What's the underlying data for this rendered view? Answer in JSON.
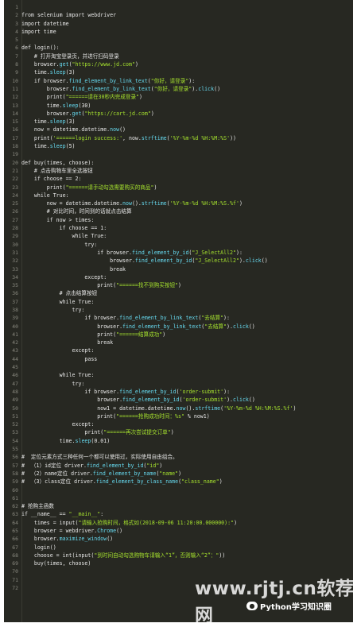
{
  "editor": {
    "lines": [
      {
        "n": "1",
        "t": ""
      },
      {
        "n": "2",
        "t": "from selenium import webdriver"
      },
      {
        "n": "3",
        "t": "import datetime"
      },
      {
        "n": "4",
        "t": "import time"
      },
      {
        "n": "5",
        "t": ""
      },
      {
        "n": "6",
        "t": "def login():"
      },
      {
        "n": "7",
        "t": "    # 打开淘宝登录页，并进行扫码登录"
      },
      {
        "n": "8",
        "t": "    browser.get(\"https://www.jd.com\")"
      },
      {
        "n": "9",
        "t": "    time.sleep(3)"
      },
      {
        "n": "10",
        "t": "    if browser.find_element_by_link_text(\"你好，请登录\"):"
      },
      {
        "n": "11",
        "t": "        browser.find_element_by_link_text(\"你好，请登录\").click()"
      },
      {
        "n": "12",
        "t": "        print(\"======请在30秒内完成登录\")"
      },
      {
        "n": "13",
        "t": "        time.sleep(30)"
      },
      {
        "n": "14",
        "t": "        browser.get(\"https://cart.jd.com\")"
      },
      {
        "n": "15",
        "t": "    time.sleep(3)"
      },
      {
        "n": "16",
        "t": "    now = datetime.datetime.now()"
      },
      {
        "n": "17",
        "t": "    print('======login success:', now.strftime('%Y-%m-%d %H:%M:%S'))"
      },
      {
        "n": "18",
        "t": "    time.sleep(5)"
      },
      {
        "n": "19",
        "t": ""
      },
      {
        "n": "20",
        "t": "def buy(times, choose):"
      },
      {
        "n": "21",
        "t": "    # 点击购物车里全选按钮"
      },
      {
        "n": "22",
        "t": "    if choose == 2:"
      },
      {
        "n": "23",
        "t": "        print(\"======请手动勾选需要购买的商品\")"
      },
      {
        "n": "24",
        "t": "    while True:"
      },
      {
        "n": "25",
        "t": "        now = datetime.datetime.now().strftime('%Y-%m-%d %H:%M:%S.%f')"
      },
      {
        "n": "26",
        "t": "        # 对比时间，时间到的话就点击结算"
      },
      {
        "n": "27",
        "t": "        if now > times:"
      },
      {
        "n": "28",
        "t": "            if choose == 1:"
      },
      {
        "n": "29",
        "t": "                while True:"
      },
      {
        "n": "30",
        "t": "                    try:"
      },
      {
        "n": "31",
        "t": "                        if browser.find_element_by_id(\"J_SelectAll2\"):"
      },
      {
        "n": "32",
        "t": "                            browser.find_element_by_id(\"J_SelectAll2\").click()"
      },
      {
        "n": "33",
        "t": "                            break"
      },
      {
        "n": "34",
        "t": "                    except:"
      },
      {
        "n": "35",
        "t": "                        print(\"======找不到购买按钮\")"
      },
      {
        "n": "36",
        "t": "            # 点击结算按钮"
      },
      {
        "n": "37",
        "t": "            while True:"
      },
      {
        "n": "38",
        "t": "                try:"
      },
      {
        "n": "39",
        "t": "                    if browser.find_element_by_link_text(\"去结算\"):"
      },
      {
        "n": "40",
        "t": "                        browser.find_element_by_link_text(\"去结算\").click()"
      },
      {
        "n": "41",
        "t": "                        print(\"======结算成功\")"
      },
      {
        "n": "42",
        "t": "                        break"
      },
      {
        "n": "43",
        "t": "                except:"
      },
      {
        "n": "44",
        "t": "                    pass"
      },
      {
        "n": "45",
        "t": ""
      },
      {
        "n": "46",
        "t": "            while True:"
      },
      {
        "n": "47",
        "t": "                try:"
      },
      {
        "n": "48",
        "t": "                    if browser.find_element_by_id('order-submit'):"
      },
      {
        "n": "49",
        "t": "                        browser.find_element_by_id('order-submit').click()"
      },
      {
        "n": "50",
        "t": "                        now1 = datetime.datetime.now().strftime('%Y-%m-%d %H:%M:%S.%f')"
      },
      {
        "n": "51",
        "t": "                        print(\"======抢购成功时间：%s\" % now1)"
      },
      {
        "n": "52",
        "t": "                except:"
      },
      {
        "n": "53",
        "t": "                    print(\"======再次尝试提交订单\")"
      },
      {
        "n": "54",
        "t": "            time.sleep(0.01)"
      },
      {
        "n": "55",
        "t": ""
      },
      {
        "n": "56",
        "t": "#  定位元素方式三种任何一个都可以使用过，实际使用自由组合。"
      },
      {
        "n": "57",
        "t": "#  （1）id定位 driver.find_element_by_id(\"id\")"
      },
      {
        "n": "58",
        "t": "#  （2）name定位 driver.find_element_by_name(\"name\")"
      },
      {
        "n": "59",
        "t": "#  （3）class定位 driver.find_element_by_class_name(\"class_name\")"
      },
      {
        "n": "60",
        "t": ""
      },
      {
        "n": "61",
        "t": ""
      },
      {
        "n": "62",
        "t": "# 抢购主函数"
      },
      {
        "n": "63",
        "t": "if __name__ == \"__main__\":"
      },
      {
        "n": "64",
        "t": "    times = input(\"请输入抢购时间，格式如(2018-09-06 11:20:00.000000):\")"
      },
      {
        "n": "65",
        "t": "    browser = webdriver.Chrome()"
      },
      {
        "n": "66",
        "t": "    browser.maximize_window()"
      },
      {
        "n": "67",
        "t": "    login()"
      },
      {
        "n": "68",
        "t": "    choose = int(input(\"到时间自动勾选购物车请输入“1”，否则输入“2”：\"))"
      },
      {
        "n": "69",
        "t": "    buy(times, choose)"
      },
      {
        "n": "70",
        "t": ""
      },
      {
        "n": "71",
        "t": ""
      },
      {
        "n": "72",
        "t": ""
      }
    ]
  },
  "overlay": {
    "watermark": "www.rjtj.cn软荐网",
    "badge_text": "Python学习知识圈",
    "badge_icon": "wechat-icon",
    "badge_glyph": "●"
  },
  "colors": {
    "background": "#272822",
    "string": "#a6e22e",
    "function": "#66d9ef",
    "text": "#e6e6e6"
  }
}
